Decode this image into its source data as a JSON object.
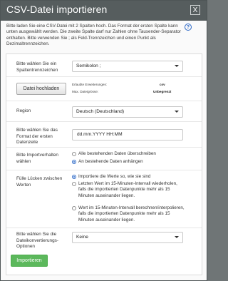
{
  "dialog": {
    "title": "CSV-Datei importieren",
    "close_glyph": "X",
    "intro": "Bitte laden Sie eine CSV-Datei mit 2 Spalten hoch. Das Format der ersten Spalte kann unten ausgewählt werden. Die zweite Spalte darf nur Zahlen ohne Tausender-Separator enthalten. Bitte verwenden Sie ; als Feld-Trennzeichen und einen Punkt als Dezimaltrennzeichen.",
    "help_glyph": "?"
  },
  "separator": {
    "label": "Bitte wählen Sie ein Spaltentrennzeichen",
    "value": "Semikolon ;"
  },
  "upload": {
    "button": "Datei hochladen",
    "ext_label": "Erlaubte Erweiterungen:",
    "ext_value": "csv",
    "size_label": "Max. Dateigrösse:",
    "size_value": "Unbegrenzt"
  },
  "region": {
    "label": "Region",
    "value": "Deutsch (Deutschland)"
  },
  "dateformat": {
    "label": "Bitte wählen Sie das Format der ersten Datenzeile",
    "value": "dd.mm.YYYY HH:MM"
  },
  "import_behavior": {
    "label": "Bitte Importverhalten wählen",
    "options": [
      "Alle bestehenden Daten überschreiben",
      "An bestehende Daten anhängen"
    ],
    "selected_index": 1
  },
  "gaps": {
    "label": "Fülle Lücken zwischen Werten",
    "options": [
      "Importiere die Werte so, wie sie sind",
      "Letzten Wert im 15-Minuten-Intervall wiederholen, falls die importierten Datenpunkte mehr als 15 Minuten auseinander liegen.",
      "Wert im 15-Minuten-Intervall berechnen/interpolieren, falls die importierten Datenpunkte mehr als 15 Minuten auseinander liegen."
    ],
    "selected_index": 0
  },
  "conversion": {
    "label": "Bitte wählen Sie die Dateikonvertierungs-Optionen",
    "value": "Keine"
  },
  "import_button": "Importieren"
}
